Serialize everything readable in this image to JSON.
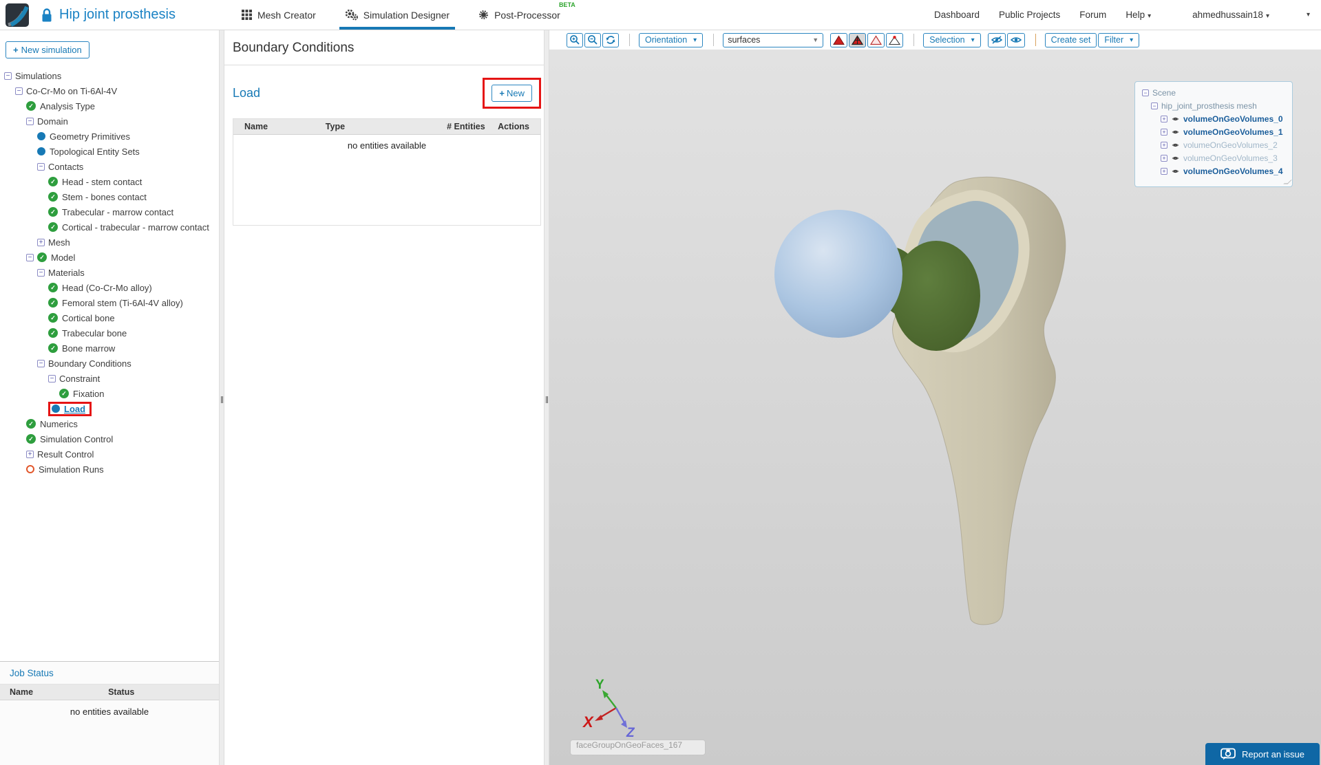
{
  "colors": {
    "accent": "#1779b5",
    "ok": "#2e9e3e",
    "annot": "#e51414",
    "report": "#0f67a5"
  },
  "icons": {
    "plus": "+",
    "minus": "−",
    "check": "✓",
    "caret_down": "▾",
    "select_caret": "▼",
    "lock": "lock-glyph-drawn-as-svg",
    "eye": "eye-glyph-drawn-as-svg"
  },
  "header": {
    "title": "Hip joint prosthesis",
    "tabs": [
      {
        "label": "Mesh Creator"
      },
      {
        "label": "Simulation Designer",
        "active": true
      },
      {
        "label": "Post-Processor",
        "badge": "BETA"
      }
    ],
    "nav": [
      {
        "label": "Dashboard"
      },
      {
        "label": "Public Projects"
      },
      {
        "label": "Forum"
      },
      {
        "label": "Help",
        "caret": true
      }
    ],
    "user": "ahmedhussain18"
  },
  "sidebar": {
    "new_simulation": "New simulation",
    "tree": [
      {
        "indent": 0,
        "expander": "minus",
        "label": "Simulations"
      },
      {
        "indent": 1,
        "expander": "minus",
        "label": "Co-Cr-Mo on Ti-6Al-4V"
      },
      {
        "indent": 2,
        "icon": "check",
        "label": "Analysis Type"
      },
      {
        "indent": 2,
        "expander": "minus",
        "label": "Domain"
      },
      {
        "indent": 3,
        "icon": "dot",
        "label": "Geometry Primitives"
      },
      {
        "indent": 3,
        "icon": "dot",
        "label": "Topological Entity Sets"
      },
      {
        "indent": 3,
        "expander": "minus",
        "label": "Contacts"
      },
      {
        "indent": 4,
        "icon": "check",
        "label": "Head - stem contact"
      },
      {
        "indent": 4,
        "icon": "check",
        "label": "Stem - bones contact"
      },
      {
        "indent": 4,
        "icon": "check",
        "label": "Trabecular - marrow contact"
      },
      {
        "indent": 4,
        "icon": "check",
        "label": "Cortical - trabecular - marrow contact"
      },
      {
        "indent": 3,
        "expander": "plus",
        "label": "Mesh"
      },
      {
        "indent": 2,
        "expander": "minus",
        "icon": "check",
        "label": "Model"
      },
      {
        "indent": 3,
        "expander": "minus",
        "label": "Materials"
      },
      {
        "indent": 4,
        "icon": "check",
        "label": "Head (Co-Cr-Mo alloy)"
      },
      {
        "indent": 4,
        "icon": "check",
        "label": "Femoral stem (Ti-6Al-4V alloy)"
      },
      {
        "indent": 4,
        "icon": "check",
        "label": "Cortical bone"
      },
      {
        "indent": 4,
        "icon": "check",
        "label": "Trabecular bone"
      },
      {
        "indent": 4,
        "icon": "check",
        "label": "Bone marrow"
      },
      {
        "indent": 3,
        "expander": "minus",
        "label": "Boundary Conditions"
      },
      {
        "indent": 4,
        "expander": "minus",
        "label": "Constraint"
      },
      {
        "indent": 5,
        "icon": "check",
        "label": "Fixation"
      },
      {
        "indent": 4,
        "icon": "dot",
        "label": "Load",
        "selected": true
      },
      {
        "indent": 2,
        "icon": "check",
        "label": "Numerics"
      },
      {
        "indent": 2,
        "icon": "check",
        "label": "Simulation Control"
      },
      {
        "indent": 2,
        "expander": "plus",
        "label": "Result Control"
      },
      {
        "indent": 2,
        "icon": "circle",
        "label": "Simulation Runs"
      }
    ]
  },
  "job_status": {
    "title": "Job Status",
    "columns": [
      "Name",
      "Status"
    ],
    "empty_text": "no entities available"
  },
  "panel": {
    "title": "Boundary Conditions",
    "section_title": "Load",
    "new_button": "New",
    "columns": [
      "Name",
      "Type",
      "# Entities",
      "Actions"
    ],
    "empty_text": "no entities available"
  },
  "viewport": {
    "toolbar": {
      "orientation": "Orientation",
      "render_select_value": "surfaces",
      "render_modes": [
        {
          "name": "surfaces-solid",
          "active": false
        },
        {
          "name": "surfaces-with-edges",
          "active": true
        },
        {
          "name": "wireframe",
          "active": false
        },
        {
          "name": "points",
          "active": false
        }
      ],
      "selection": "Selection",
      "create_set": "Create set",
      "filter": "Filter"
    },
    "scene_tree": {
      "root": "Scene",
      "mesh": "hip_joint_prosthesis mesh",
      "volumes": [
        {
          "label": "volumeOnGeoVolumes_0",
          "bold": true
        },
        {
          "label": "volumeOnGeoVolumes_1",
          "bold": true
        },
        {
          "label": "volumeOnGeoVolumes_2",
          "bold": false
        },
        {
          "label": "volumeOnGeoVolumes_3",
          "bold": false
        },
        {
          "label": "volumeOnGeoVolumes_4",
          "bold": true
        }
      ]
    },
    "axis": {
      "x": "X",
      "y": "Y",
      "z": "Z"
    },
    "face_input_value": "faceGroupOnGeoFaces_167",
    "report_button": "Report an issue"
  }
}
